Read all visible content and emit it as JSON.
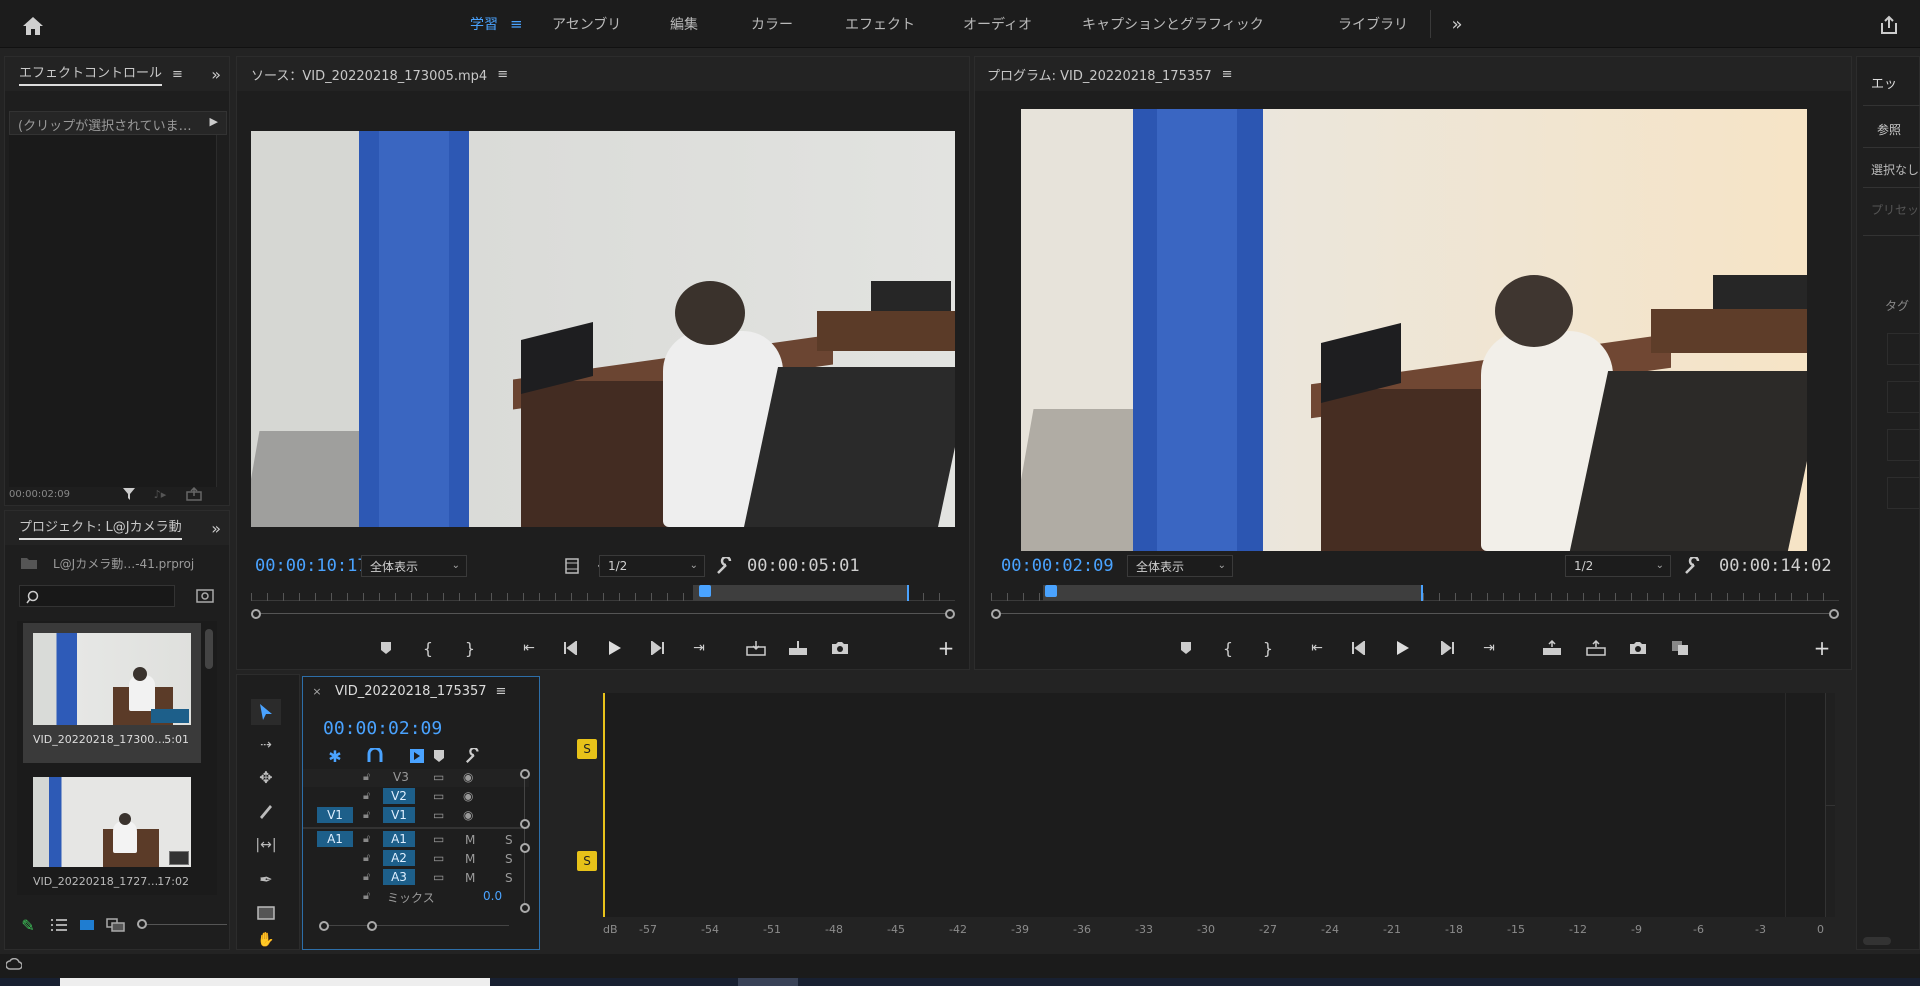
{
  "header": {
    "tabs": [
      {
        "label": "学習"
      },
      {
        "label": "アセンブリ"
      },
      {
        "label": "編集"
      },
      {
        "label": "カラー"
      },
      {
        "label": "エフェクト"
      },
      {
        "label": "オーディオ"
      },
      {
        "label": "キャプションとグラフィック"
      },
      {
        "label": "ライブラリ"
      }
    ],
    "more": "»",
    "colors": {
      "active": "#4aa3ff"
    }
  },
  "effect_controls": {
    "title": "エフェクトコントロール",
    "clip_placeholder": "(クリップが選択されていま…",
    "timecode": "00:00:02:09"
  },
  "project": {
    "title": "プロジェクト: L@Jカメラ動",
    "file": "L@Jカメラ動…-41.prproj",
    "search_placeholder": "",
    "items": [
      {
        "name": "VID_20220218_17300…",
        "duration": "5:01"
      },
      {
        "name": "VID_20220218_1727…",
        "duration": "17:02"
      }
    ]
  },
  "source": {
    "title": "ソース：VID_20220218_173005.mp4",
    "timecode": "00:00:10:17",
    "fit": "全体表示",
    "resolution": "1/2",
    "duration": "00:00:05:01"
  },
  "program": {
    "title": "プログラム: VID_20220218_175357",
    "timecode": "00:00:02:09",
    "fit": "全体表示",
    "resolution": "1/2",
    "duration": "00:00:14:02"
  },
  "timeline": {
    "tab": "VID_20220218_175357",
    "timecode": "00:00:02:09",
    "tracks": {
      "v3": "V3",
      "v2": "V2",
      "v1": "V1",
      "src_v1": "V1",
      "src_a1": "A1",
      "a1": "A1",
      "a2": "A2",
      "a3": "A3",
      "mix": "ミックス",
      "mix_value": "0.0",
      "m": "M",
      "s": "S"
    }
  },
  "audio_meter": {
    "solo_label": "S",
    "db_label": "dB",
    "ticks": [
      "-57",
      "-54",
      "-51",
      "-48",
      "-45",
      "-42",
      "-39",
      "-36",
      "-33",
      "-30",
      "-27",
      "-24",
      "-21",
      "-18",
      "-15",
      "-12",
      "-9",
      "-6",
      "-3",
      "0"
    ]
  },
  "right_panel": {
    "title": "エッ",
    "browse": "参照",
    "none": "選択なし",
    "preset": "プリセッ",
    "tag": "タグ"
  }
}
